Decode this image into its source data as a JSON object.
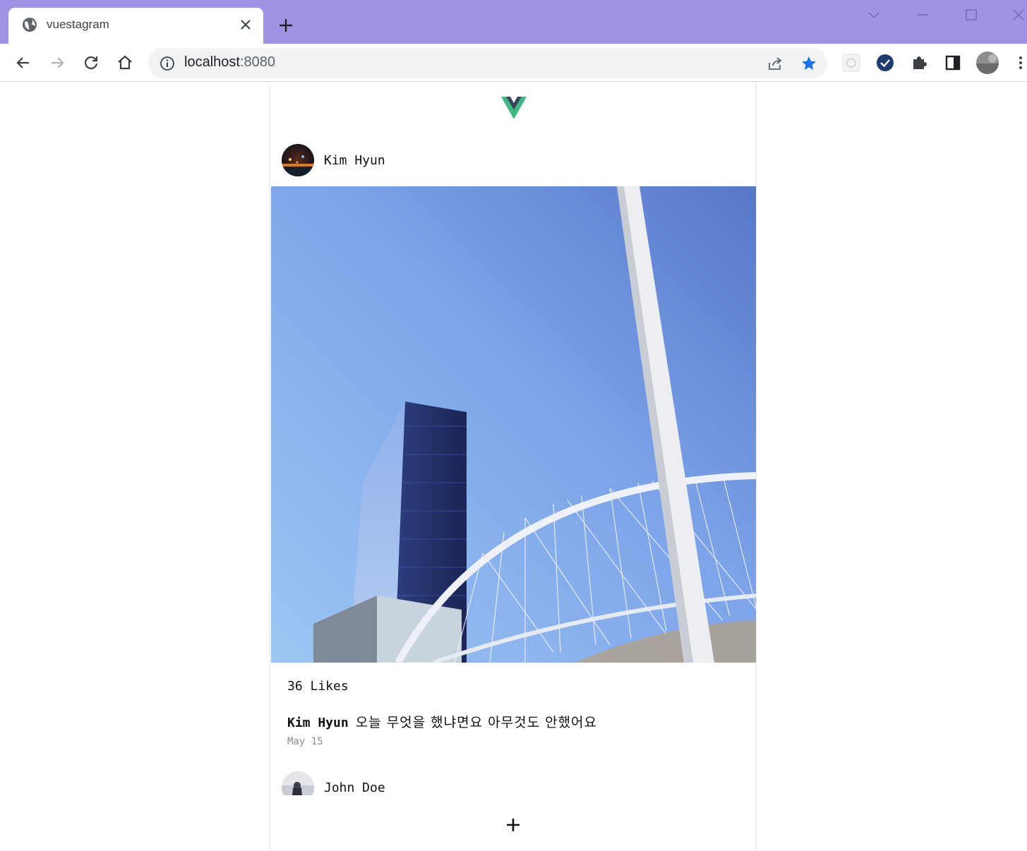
{
  "browser": {
    "tab_title": "vuestagram",
    "url_host": "localhost",
    "url_port": ":8080",
    "accent": "#a093e6",
    "star_color": "#1a73e8"
  },
  "posts": [
    {
      "name": "Kim Hyun",
      "likes_text": "36 Likes",
      "caption_name": "Kim Hyun",
      "caption": "오늘 무엇을 했냐면요 아무것도 안했어요",
      "date": "May 15"
    },
    {
      "name": "John Doe"
    }
  ],
  "footer": {
    "icon": "plus-icon"
  }
}
